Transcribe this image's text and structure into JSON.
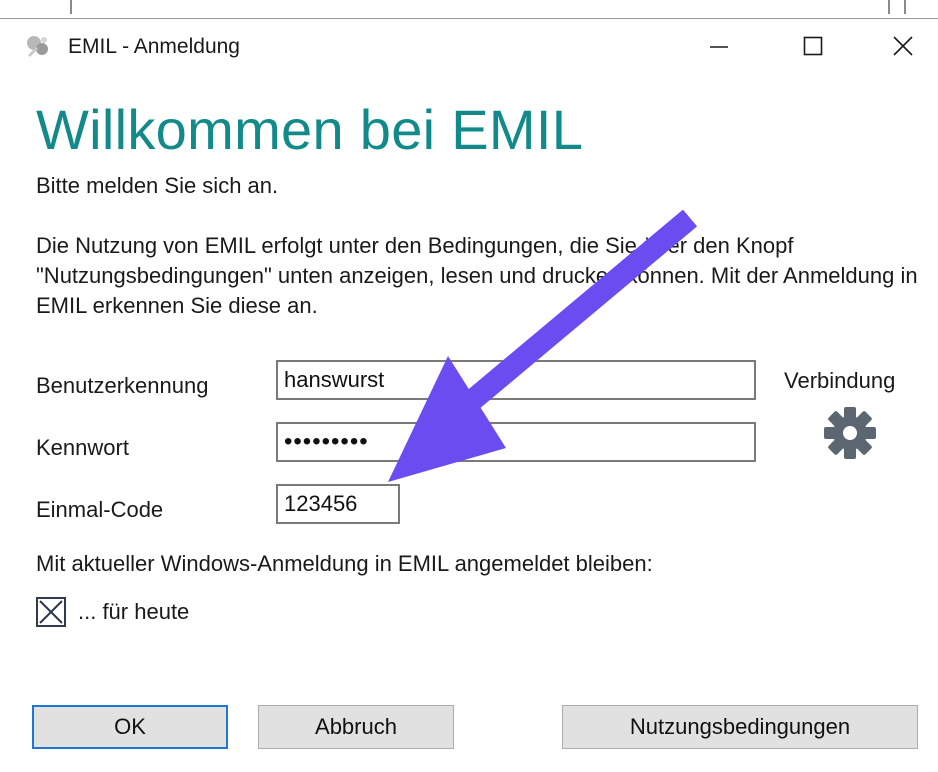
{
  "window": {
    "title": "EMIL - Anmeldung",
    "controls": {
      "minimize": "minimize",
      "maximize": "maximize",
      "close": "close"
    }
  },
  "main": {
    "heading": "Willkommen bei EMIL",
    "subtitle": "Bitte melden Sie sich an.",
    "terms_notice": "Die Nutzung von EMIL erfolgt unter den Bedingungen, die Sie über den Knopf \"Nutzungsbedingungen\" unten anzeigen, lesen und drucken können. Mit der Anmeldung in EMIL erkennen Sie diese an."
  },
  "form": {
    "username_label": "Benutzerkennung",
    "username_value": "hanswurst",
    "password_label": "Kennwort",
    "password_value": "•••••••••",
    "otp_label": "Einmal-Code",
    "otp_value": "123456",
    "connection_label": "Verbindung",
    "connection_icon": "gear-icon",
    "remember_text": "Mit aktueller Windows-Anmeldung in EMIL angemeldet bleiben:",
    "remember_checkbox_label": "... für heute",
    "remember_checked": true
  },
  "buttons": {
    "ok": "OK",
    "cancel": "Abbruch",
    "terms": "Nutzungsbedingungen"
  },
  "colors": {
    "heading": "#138a8a",
    "annotation_arrow": "#6a4cf0",
    "ok_border": "#1c78d4",
    "button_face": "#e1e1e1"
  }
}
